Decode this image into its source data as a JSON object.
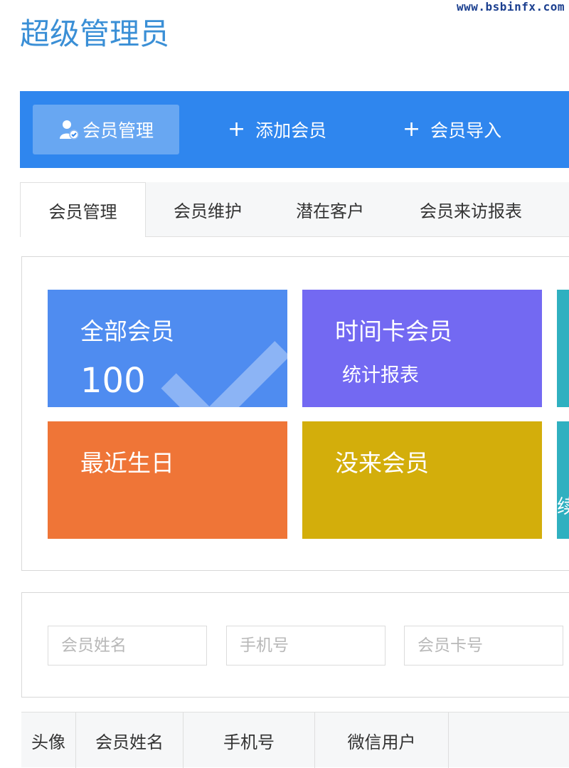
{
  "watermark": "www.bsbinfx.com",
  "page_title": "超级管理员",
  "topbar": {
    "items": [
      {
        "label": "会员管理",
        "icon": "user-check-icon"
      },
      {
        "label": "添加会员",
        "icon": "plus-icon"
      },
      {
        "label": "会员导入",
        "icon": "plus-icon"
      }
    ]
  },
  "tabs": [
    {
      "label": "会员管理"
    },
    {
      "label": "会员维护"
    },
    {
      "label": "潜在客户"
    },
    {
      "label": "会员来访报表"
    }
  ],
  "tiles": [
    {
      "title": "全部会员",
      "count": "100",
      "color": "#4f8cf0"
    },
    {
      "title": "时间卡会员",
      "subtitle": "统计报表",
      "color": "#7369f2"
    },
    {
      "title": "最近生日",
      "color": "#ef7537"
    },
    {
      "title": "没来会员",
      "color": "#d3ae0b"
    },
    {
      "partial_text": "续",
      "color": "#2fb0c0"
    }
  ],
  "filter": {
    "name_placeholder": "会员姓名",
    "phone_placeholder": "手机号",
    "card_placeholder": "会员卡号"
  },
  "table": {
    "headers": [
      "头像",
      "会员姓名",
      "手机号",
      "微信用户"
    ]
  }
}
